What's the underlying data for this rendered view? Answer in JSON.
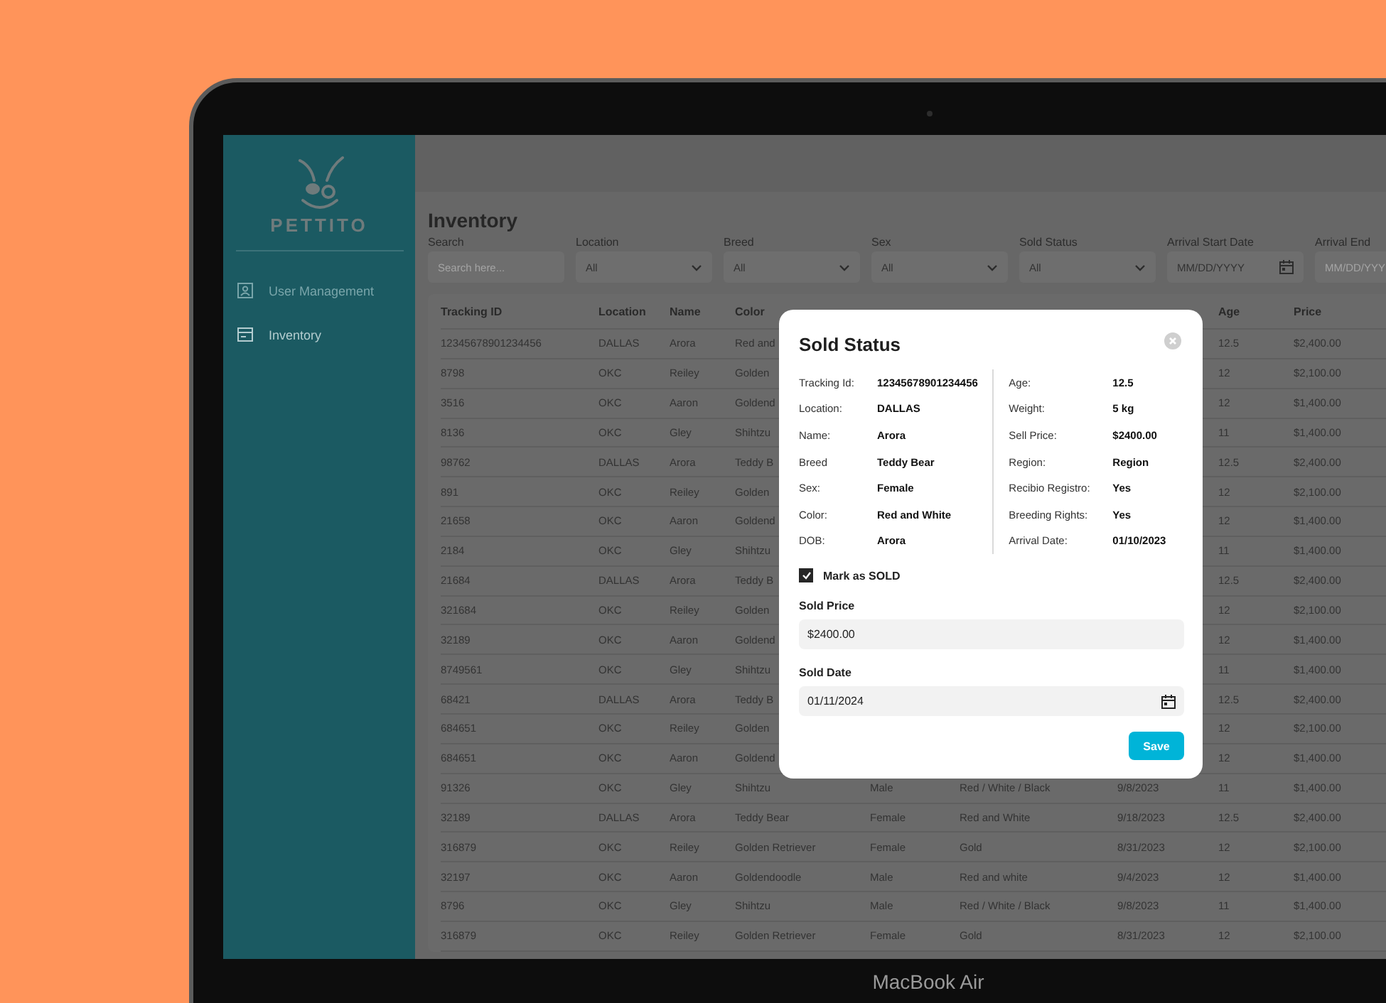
{
  "device": {
    "label": "MacBook Air"
  },
  "sidebar": {
    "logo_text": "PETTITO",
    "items": [
      {
        "label": "User Management",
        "selected": false,
        "kind": "user"
      },
      {
        "label": "Inventory",
        "selected": true,
        "kind": "inventory"
      }
    ]
  },
  "page": {
    "title": "Inventory"
  },
  "filters": [
    {
      "label": "Search",
      "placeholder": "Search here...",
      "kind": "text"
    },
    {
      "label": "Location",
      "value": "All",
      "kind": "select"
    },
    {
      "label": "Breed",
      "value": "All",
      "kind": "select"
    },
    {
      "label": "Sex",
      "value": "All",
      "kind": "select"
    },
    {
      "label": "Sold Status",
      "value": "All",
      "kind": "select"
    },
    {
      "label": "Arrival Start Date",
      "placeholder": "MM/DD/YYYY",
      "kind": "date"
    },
    {
      "label": "Arrival End",
      "placeholder": "MM/DD/YYY",
      "kind": "text"
    }
  ],
  "table": {
    "columns": [
      {
        "label": "Tracking ID"
      },
      {
        "label": "Location"
      },
      {
        "label": "Name"
      },
      {
        "label": "Color"
      },
      {
        "label": "Age"
      },
      {
        "label": "Price"
      }
    ],
    "rows": [
      {
        "cells": [
          "12345678901234456",
          "DALLAS",
          "Arora",
          "Red and"
        ],
        "age": "12.5",
        "price": "$2,400.00"
      },
      {
        "cells": [
          "8798",
          "OKC",
          "Reiley",
          "Golden"
        ],
        "age": "12",
        "price": "$2,100.00"
      },
      {
        "cells": [
          "3516",
          "OKC",
          "Aaron",
          "Goldend"
        ],
        "age": "12",
        "price": "$1,400.00"
      },
      {
        "cells": [
          "8136",
          "OKC",
          "Gley",
          "Shihtzu"
        ],
        "age": "11",
        "price": "$1,400.00"
      },
      {
        "cells": [
          "98762",
          "DALLAS",
          "Arora",
          "Teddy B"
        ],
        "age": "12.5",
        "price": "$2,400.00"
      },
      {
        "cells": [
          "891",
          "OKC",
          "Reiley",
          "Golden"
        ],
        "age": "12",
        "price": "$2,100.00"
      },
      {
        "cells": [
          "21658",
          "OKC",
          "Aaron",
          "Goldend"
        ],
        "age": "12",
        "price": "$1,400.00"
      },
      {
        "cells": [
          "2184",
          "OKC",
          "Gley",
          "Shihtzu"
        ],
        "age": "11",
        "price": "$1,400.00"
      },
      {
        "cells": [
          "21684",
          "DALLAS",
          "Arora",
          "Teddy B"
        ],
        "age": "12.5",
        "price": "$2,400.00"
      },
      {
        "cells": [
          "321684",
          "OKC",
          "Reiley",
          "Golden"
        ],
        "age": "12",
        "price": "$2,100.00"
      },
      {
        "cells": [
          "32189",
          "OKC",
          "Aaron",
          "Goldend"
        ],
        "age": "12",
        "price": "$1,400.00"
      },
      {
        "cells": [
          "8749561",
          "OKC",
          "Gley",
          "Shihtzu"
        ],
        "age": "11",
        "price": "$1,400.00"
      },
      {
        "cells": [
          "68421",
          "DALLAS",
          "Arora",
          "Teddy B"
        ],
        "age": "12.5",
        "price": "$2,400.00"
      },
      {
        "cells": [
          "684651",
          "OKC",
          "Reiley",
          "Golden"
        ],
        "age": "12",
        "price": "$2,100.00"
      },
      {
        "cells": [
          "684651",
          "OKC",
          "Aaron",
          "Goldend"
        ],
        "age": "12",
        "price": "$1,400.00"
      },
      {
        "cells": [
          "91326",
          "OKC",
          "Gley",
          "Shihtzu",
          "Male",
          "Red / White / Black",
          "9/8/2023"
        ],
        "age": "11",
        "price": "$1,400.00"
      },
      {
        "cells": [
          "32189",
          "DALLAS",
          "Arora",
          "Teddy Bear",
          "Female",
          "Red and White",
          "9/18/2023"
        ],
        "age": "12.5",
        "price": "$2,400.00"
      },
      {
        "cells": [
          "316879",
          "OKC",
          "Reiley",
          "Golden Retriever",
          "Female",
          "Gold",
          "8/31/2023"
        ],
        "age": "12",
        "price": "$2,100.00"
      },
      {
        "cells": [
          "32197",
          "OKC",
          "Aaron",
          "Goldendoodle",
          "Male",
          "Red and white",
          "9/4/2023"
        ],
        "age": "12",
        "price": "$1,400.00"
      },
      {
        "cells": [
          "8796",
          "OKC",
          "Gley",
          "Shihtzu",
          "Male",
          "Red / White / Black",
          "9/8/2023"
        ],
        "age": "11",
        "price": "$1,400.00"
      },
      {
        "cells": [
          "316879",
          "OKC",
          "Reiley",
          "Golden Retriever",
          "Female",
          "Gold",
          "8/31/2023"
        ],
        "age": "12",
        "price": "$2,100.00"
      }
    ]
  },
  "modal": {
    "title": "Sold Status",
    "details_left": [
      {
        "label": "Tracking Id:",
        "value": "12345678901234456"
      },
      {
        "label": "Location:",
        "value": "DALLAS"
      },
      {
        "label": "Name:",
        "value": "Arora"
      },
      {
        "label": "Breed",
        "value": "Teddy Bear"
      },
      {
        "label": "Sex:",
        "value": "Female"
      },
      {
        "label": "Color:",
        "value": "Red and White"
      },
      {
        "label": "DOB:",
        "value": "Arora"
      }
    ],
    "details_right": [
      {
        "label": "Age:",
        "value": "12.5"
      },
      {
        "label": "Weight:",
        "value": "5 kg"
      },
      {
        "label": "Sell Price:",
        "value": "$2400.00"
      },
      {
        "label": "Region:",
        "value": "Region"
      },
      {
        "label": "Recibio Registro:",
        "value": "Yes"
      },
      {
        "label": "Breeding Rights:",
        "value": "Yes"
      },
      {
        "label": "Arrival Date:",
        "value": "01/10/2023"
      }
    ],
    "mark_sold": {
      "label": "Mark as SOLD",
      "checked": true
    },
    "sold_price": {
      "label": "Sold Price",
      "value": "$2400.00"
    },
    "sold_date": {
      "label": "Sold Date",
      "value": "01/11/2024"
    },
    "save_label": "Save"
  }
}
